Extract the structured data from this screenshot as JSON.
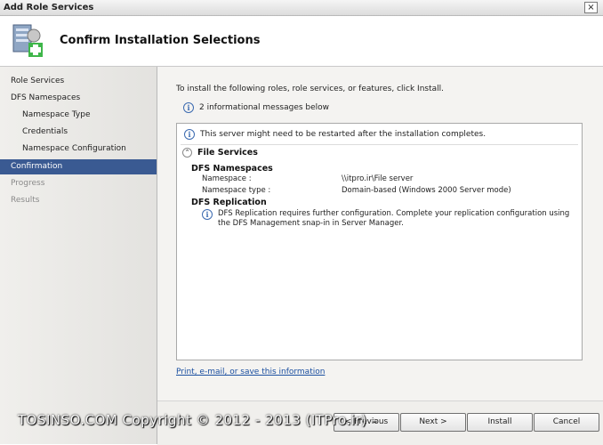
{
  "window": {
    "title": "Add Role Services",
    "close_glyph": "×"
  },
  "header": {
    "title": "Confirm Installation Selections",
    "icon": "server-roles-add-icon"
  },
  "nav": {
    "items": [
      {
        "label": "Role Services",
        "state": "normal"
      },
      {
        "label": "DFS Namespaces",
        "state": "normal"
      },
      {
        "label": "Namespace Type",
        "state": "normal"
      },
      {
        "label": "Credentials",
        "state": "normal"
      },
      {
        "label": "Namespace Configuration",
        "state": "normal"
      },
      {
        "label": "Confirmation",
        "state": "active"
      },
      {
        "label": "Progress",
        "state": "disabled"
      },
      {
        "label": "Results",
        "state": "disabled"
      }
    ]
  },
  "main": {
    "intro": "To install the following roles, role services, or features, click Install.",
    "info_count_text": "2 informational messages below",
    "details": {
      "restart_msg": "This server might need to be restarted after the installation completes.",
      "section_title": "File Services",
      "dfs_namespaces": {
        "heading": "DFS Namespaces",
        "namespace_label": "Namespace :",
        "namespace_value": "\\\\itpro.ir\\File server",
        "type_label": "Namespace type :",
        "type_value": "Domain-based (Windows 2000 Server mode)"
      },
      "dfs_replication": {
        "heading": "DFS Replication",
        "message": "DFS Replication requires further configuration. Complete your replication configuration using the DFS Management snap-in in Server Manager."
      }
    },
    "link_text": "Print, e-mail, or save this information"
  },
  "footer": {
    "previous_label": "< Previous",
    "next_label": "Next >",
    "install_label": "Install",
    "cancel_label": "Cancel"
  },
  "watermark": "TOSINSO.COM  Copyright © 2012 - 2013 (ITPro.ir) -"
}
